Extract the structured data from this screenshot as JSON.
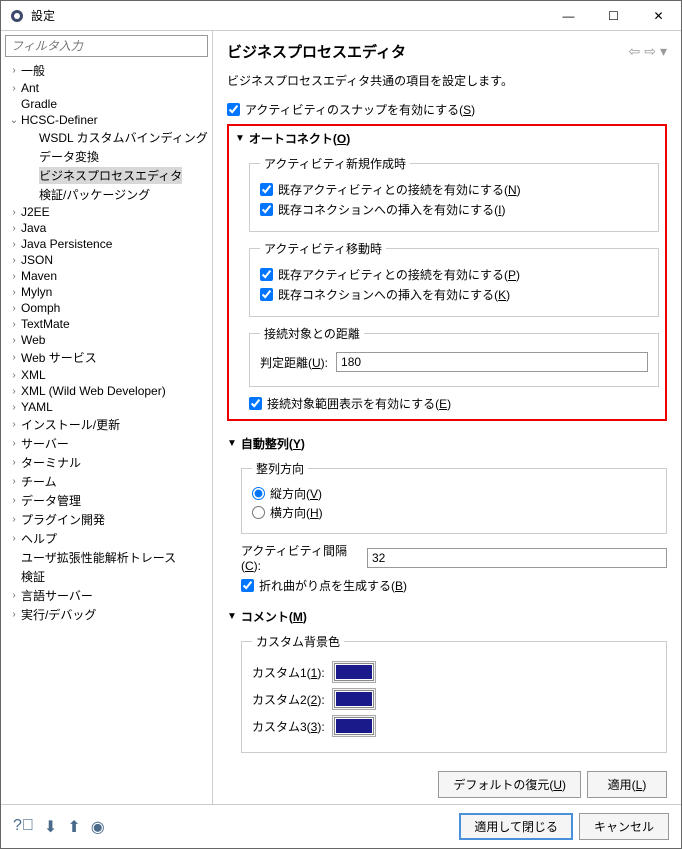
{
  "window": {
    "title": "設定"
  },
  "filter": {
    "placeholder": "フィルタ入力"
  },
  "tree": [
    {
      "label": "一般",
      "level": 1,
      "expand": "closed"
    },
    {
      "label": "Ant",
      "level": 1,
      "expand": "closed"
    },
    {
      "label": "Gradle",
      "level": 1,
      "expand": "none"
    },
    {
      "label": "HCSC-Definer",
      "level": 1,
      "expand": "open"
    },
    {
      "label": "WSDL カスタムバインディング",
      "level": 2,
      "expand": "none"
    },
    {
      "label": "データ変換",
      "level": 2,
      "expand": "none"
    },
    {
      "label": "ビジネスプロセスエディタ",
      "level": 2,
      "expand": "none",
      "selected": true
    },
    {
      "label": "検証/パッケージング",
      "level": 2,
      "expand": "none"
    },
    {
      "label": "J2EE",
      "level": 1,
      "expand": "closed"
    },
    {
      "label": "Java",
      "level": 1,
      "expand": "closed"
    },
    {
      "label": "Java Persistence",
      "level": 1,
      "expand": "closed"
    },
    {
      "label": "JSON",
      "level": 1,
      "expand": "closed"
    },
    {
      "label": "Maven",
      "level": 1,
      "expand": "closed"
    },
    {
      "label": "Mylyn",
      "level": 1,
      "expand": "closed"
    },
    {
      "label": "Oomph",
      "level": 1,
      "expand": "closed"
    },
    {
      "label": "TextMate",
      "level": 1,
      "expand": "closed"
    },
    {
      "label": "Web",
      "level": 1,
      "expand": "closed"
    },
    {
      "label": "Web サービス",
      "level": 1,
      "expand": "closed"
    },
    {
      "label": "XML",
      "level": 1,
      "expand": "closed"
    },
    {
      "label": "XML (Wild Web Developer)",
      "level": 1,
      "expand": "closed"
    },
    {
      "label": "YAML",
      "level": 1,
      "expand": "closed"
    },
    {
      "label": "インストール/更新",
      "level": 1,
      "expand": "closed"
    },
    {
      "label": "サーバー",
      "level": 1,
      "expand": "closed"
    },
    {
      "label": "ターミナル",
      "level": 1,
      "expand": "closed"
    },
    {
      "label": "チーム",
      "level": 1,
      "expand": "closed"
    },
    {
      "label": "データ管理",
      "level": 1,
      "expand": "closed"
    },
    {
      "label": "プラグイン開発",
      "level": 1,
      "expand": "closed"
    },
    {
      "label": "ヘルプ",
      "level": 1,
      "expand": "closed"
    },
    {
      "label": "ユーザ拡張性能解析トレース",
      "level": 1,
      "expand": "none"
    },
    {
      "label": "検証",
      "level": 1,
      "expand": "none"
    },
    {
      "label": "言語サーバー",
      "level": 1,
      "expand": "closed"
    },
    {
      "label": "実行/デバッグ",
      "level": 1,
      "expand": "closed"
    }
  ],
  "page": {
    "title": "ビジネスプロセスエディタ",
    "description": "ビジネスプロセスエディタ共通の項目を設定します。",
    "snap": {
      "label": "アクティビティのスナップを有効にする(",
      "mnemonic": "S",
      "suffix": ")",
      "checked": true
    },
    "autoconnect": {
      "header": "オートコネクト(",
      "mnemonic": "O",
      "suffix": ")",
      "new_title": "アクティビティ新規作成時",
      "new_conn": {
        "label": "既存アクティビティとの接続を有効にする(",
        "m": "N",
        "s": ")",
        "checked": true
      },
      "new_ins": {
        "label": "既存コネクションへの挿入を有効にする(",
        "m": "I",
        "s": ")",
        "checked": true
      },
      "move_title": "アクティビティ移動時",
      "move_conn": {
        "label": "既存アクティビティとの接続を有効にする(",
        "m": "P",
        "s": ")",
        "checked": true
      },
      "move_ins": {
        "label": "既存コネクションへの挿入を有効にする(",
        "m": "K",
        "s": ")",
        "checked": true
      },
      "dist_title": "接続対象との距離",
      "dist_label": "判定距離(",
      "dist_m": "U",
      "dist_s": "):",
      "dist_value": "180",
      "range": {
        "label": "接続対象範囲表示を有効にする(",
        "m": "E",
        "s": ")",
        "checked": true
      }
    },
    "autoalign": {
      "header": "自動整列(",
      "mnemonic": "Y",
      "suffix": ")",
      "dir_title": "整列方向",
      "vertical": {
        "label": "縦方向(",
        "m": "V",
        "s": ")",
        "checked": true
      },
      "horizontal": {
        "label": "横方向(",
        "m": "H",
        "s": ")",
        "checked": false
      },
      "gap_label": "アクティビティ間隔(",
      "gap_m": "C",
      "gap_s": "):",
      "gap_value": "32",
      "bend": {
        "label": "折れ曲がり点を生成する(",
        "m": "B",
        "s": ")",
        "checked": true
      }
    },
    "comment": {
      "header": "コメント(",
      "mnemonic": "M",
      "suffix": ")",
      "bg_title": "カスタム背景色",
      "c1": {
        "label": "カスタム1(",
        "m": "1",
        "s": "):",
        "color": "#1a1a8a"
      },
      "c2": {
        "label": "カスタム2(",
        "m": "2",
        "s": "):",
        "color": "#1a1a8a"
      },
      "c3": {
        "label": "カスタム3(",
        "m": "3",
        "s": "):",
        "color": "#1a1a8a"
      }
    },
    "restore": {
      "label": "デフォルトの復元(",
      "m": "U",
      "s": ")"
    },
    "apply": {
      "label": "適用(",
      "m": "L",
      "s": ")"
    }
  },
  "footer": {
    "apply_close": "適用して閉じる",
    "cancel": "キャンセル"
  }
}
